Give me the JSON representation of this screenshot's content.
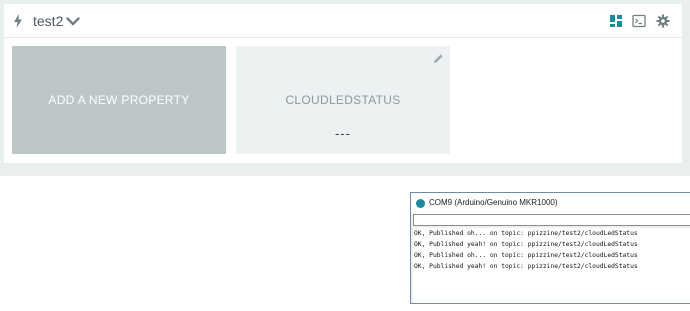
{
  "header": {
    "thing_name": "test2",
    "icons": {
      "thing": "lightning-bolt-icon",
      "expand": "chevron-down-icon",
      "dashboard": "dashboard-grid-icon",
      "terminal": "terminal-icon",
      "settings": "gear-icon"
    }
  },
  "tiles": {
    "add": {
      "label": "ADD A NEW PROPERTY"
    },
    "property": {
      "name": "CLOUDLEDSTATUS",
      "value": "---",
      "edit_icon": "pencil-icon"
    }
  },
  "serial_monitor": {
    "title": "COM9 (Arduino/Genuino MKR1000)",
    "input_value": "",
    "lines": [
      "OK, Published oh... on topic: ppizzine/test2/cloudLedStatus",
      "OK, Published yeah! on topic: ppizzine/test2/cloudLedStatus",
      "OK, Published oh... on topic: ppizzine/test2/cloudLedStatus",
      "OK, Published yeah! on topic: ppizzine/test2/cloudLedStatus"
    ]
  },
  "colors": {
    "accent_teal": "#1a8c9b",
    "add_tile": "#bcc6c6",
    "property_tile": "#ecf1f1",
    "icon_gray": "#6f7f84"
  }
}
